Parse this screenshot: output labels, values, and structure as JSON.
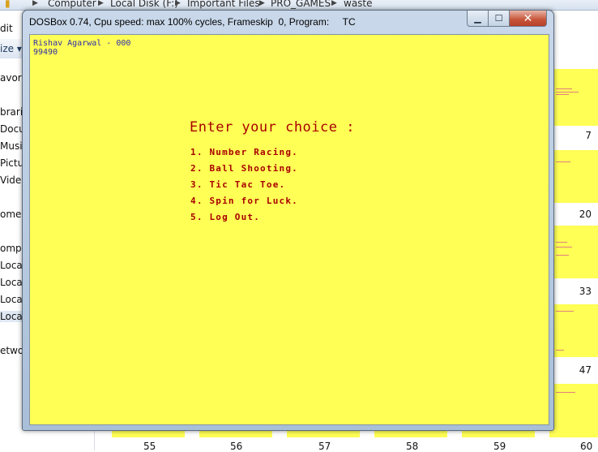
{
  "explorer": {
    "breadcrumb": [
      "Computer",
      "Local Disk (F:)",
      "Important Files",
      "PRO_GAMES",
      "waste"
    ],
    "menu_partial": "dit",
    "organize_partial": "ize ▾",
    "sidebar": [
      "avorit",
      "brarie",
      "Docu",
      "Musi",
      "Pictu",
      "Videc",
      "omeg",
      "ompu",
      "Local",
      "Local",
      "Local",
      "Local",
      "etwor"
    ],
    "right_numbers": [
      "7",
      "20",
      "33",
      "47"
    ],
    "bottom_numbers": [
      "55",
      "56",
      "57",
      "58",
      "59",
      "60"
    ]
  },
  "window": {
    "title": "DOSBox 0.74, Cpu speed: max 100% cycles, Frameskip  0, Program:     TC",
    "minimize_icon": "minimize-icon",
    "maximize_icon": "maximize-icon",
    "close_icon": "close-icon"
  },
  "screen": {
    "user_line": "Rishav Agarwal - 000",
    "score_line": "99490",
    "prompt": "Enter your choice :",
    "options": [
      "1. Number Racing.",
      "2. Ball Shooting.",
      "3. Tic Tac Toe.",
      "4. Spin for Luck.",
      "5. Log Out."
    ]
  },
  "colors": {
    "dos_background": "#ffff55",
    "dos_text": "#a80000",
    "dos_header_text": "#2e2ea8"
  }
}
